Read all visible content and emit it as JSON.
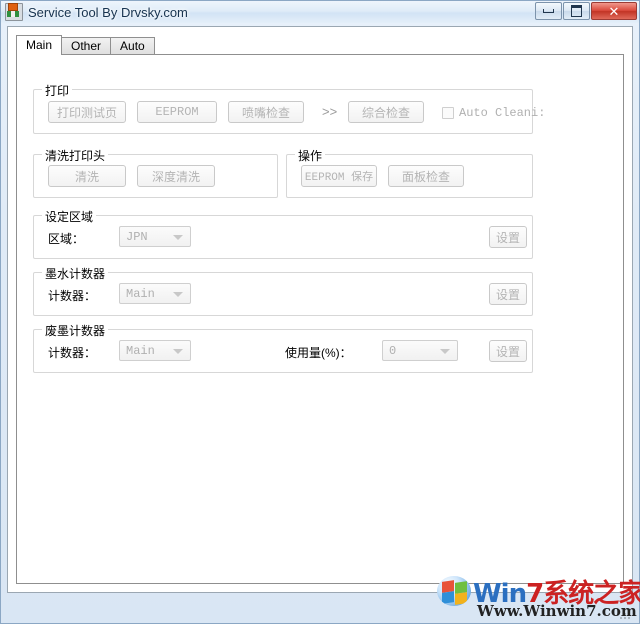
{
  "window": {
    "title": "Service Tool By Drvsky.com",
    "icon": "app-printer-icon",
    "minimize_label": "Minimize",
    "maximize_label": "Maximize",
    "close_label": "✕"
  },
  "tabs": [
    {
      "label": "Main",
      "active": true
    },
    {
      "label": "Other",
      "active": false
    },
    {
      "label": "Auto",
      "active": false
    }
  ],
  "groups": {
    "print": {
      "caption": "打印",
      "buttons": [
        {
          "label": "打印测试页"
        },
        {
          "label": "EEPROM"
        },
        {
          "label": "喷嘴检查"
        },
        {
          "label": "综合检查"
        }
      ],
      "separator": ">>",
      "checkbox": {
        "label": "Auto Cleani:",
        "checked": false
      }
    },
    "clean_head": {
      "caption": "清洗打印头",
      "buttons": [
        {
          "label": "清洗"
        },
        {
          "label": "深度清洗"
        }
      ]
    },
    "operation": {
      "caption": "操作",
      "buttons": [
        {
          "label": "EEPROM 保存"
        },
        {
          "label": "面板检查"
        }
      ]
    },
    "region": {
      "caption": "设定区域",
      "field_label": "区域：",
      "combo_value": "JPN",
      "set_label": "设置"
    },
    "ink_counter": {
      "caption": "墨水计数器",
      "field_label": "计数器：",
      "combo_value": "Main",
      "set_label": "设置"
    },
    "waste_counter": {
      "caption": "废墨计数器",
      "field_label": "计数器：",
      "combo_value": "Main",
      "usage_label": "使用量(%)：",
      "usage_value": "0",
      "set_label": "设置"
    }
  },
  "watermark": {
    "brand_win": "Win",
    "brand_seven": "7",
    "brand_cn": "系统之家",
    "url": "Www.Winwin7.com"
  }
}
